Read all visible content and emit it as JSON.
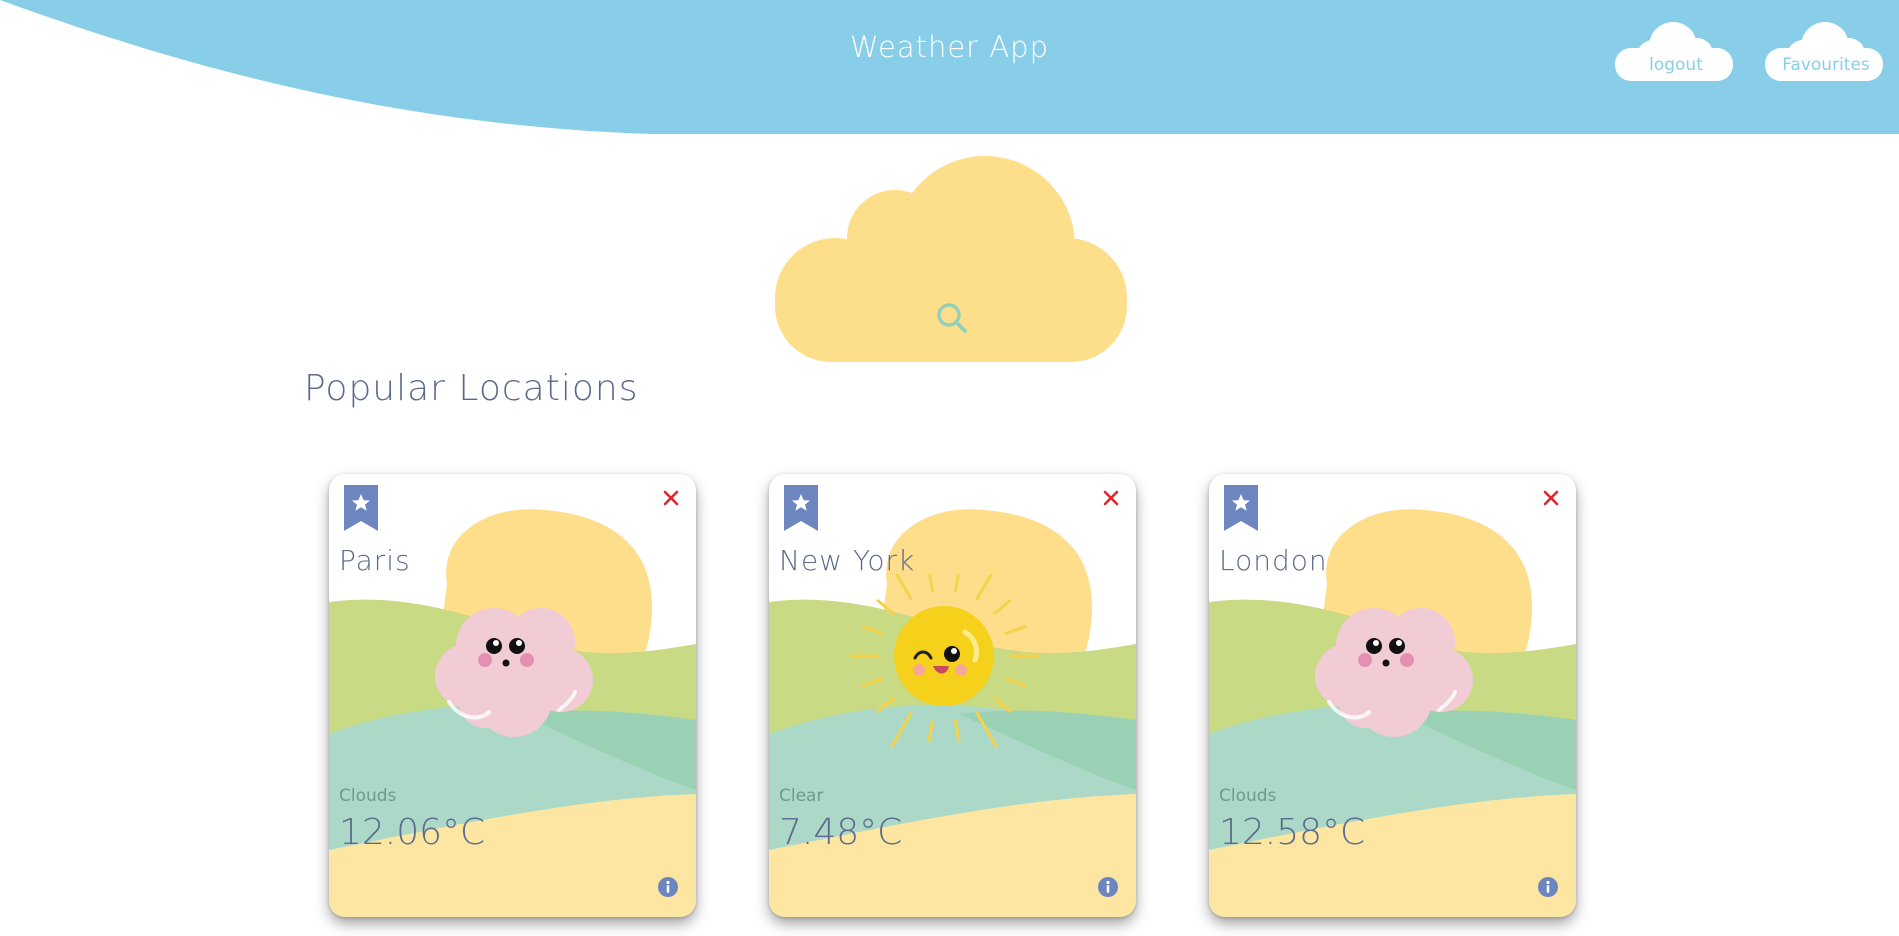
{
  "header": {
    "title": "Weather App",
    "logout_label": "logout",
    "favourites_label": "Favourites",
    "bg_color": "#89cee9"
  },
  "search": {
    "icon": "search-icon",
    "cloud_color": "#fdde8b"
  },
  "section": {
    "title": "Popular Locations"
  },
  "cards": [
    {
      "city": "Paris",
      "condition": "Clouds",
      "temp": "12.06°C",
      "icon": "cloud-face-icon"
    },
    {
      "city": "New York",
      "condition": "Clear",
      "temp": "7.48°C",
      "icon": "sun-face-icon"
    },
    {
      "city": "London",
      "condition": "Clouds",
      "temp": "12.58°C",
      "icon": "cloud-face-icon"
    }
  ],
  "colors": {
    "text": "#5b6a8c",
    "bookmark": "#6e86bf",
    "close": "#e3242b",
    "hill_green": "#c9da85",
    "hill_teal": "#acd8c8",
    "hill_mint": "#9ad1b4",
    "sand": "#fde6a1",
    "sun_blob": "#fedd8b"
  }
}
